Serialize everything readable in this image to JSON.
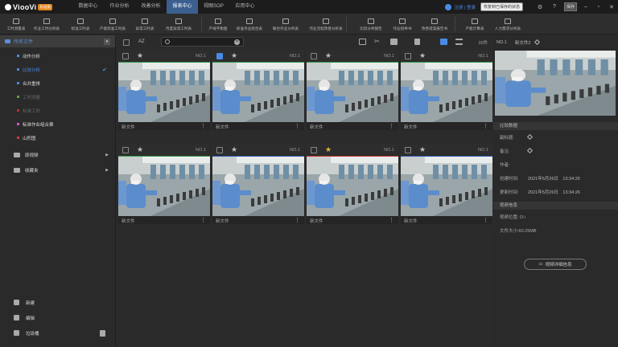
{
  "app": {
    "name": "ViooVi",
    "badge": "标准版"
  },
  "nav": [
    "数据中心",
    "作业分析",
    "改善分析",
    "报表中心",
    "视图SOP",
    "应用中心"
  ],
  "nav_active": 3,
  "topright": {
    "login": "注册 | 登录",
    "restore": "恢复到已保存的状态",
    "save": "保存"
  },
  "toolbar": [
    "工时测量表",
    "作业工时分析表",
    "标准工时表",
    "产能标准工时表",
    "异常工时表",
    "月度异常工时表",
    "产线平衡图",
    "标准作业组合表",
    "联合作业分析表",
    "作业流程改善分析表",
    "比较分析报告",
    "作业指导书",
    "改善提案报告书",
    "产能计算表",
    "人力需求分析表"
  ],
  "sidebar": {
    "root": "所有文件",
    "items": [
      {
        "label": "动作分析",
        "color": "#4a8ae6"
      },
      {
        "label": "比较分析",
        "color": "#4a8ae6",
        "selected": true
      },
      {
        "label": "合并重排",
        "color": "#4a8ae6"
      },
      {
        "label": "工时测量",
        "color": "#6b9a3b",
        "dim": true
      },
      {
        "label": "标准工时",
        "color": "#b2372e",
        "dim": true
      },
      {
        "label": "标准作业组合票",
        "color": "#d255c8"
      },
      {
        "label": "山积图",
        "color": "#d43b3b"
      }
    ],
    "groups": [
      "原视频",
      "收藏夹"
    ],
    "bottom": [
      "新建",
      "编辑",
      "垃圾桶"
    ]
  },
  "main": {
    "sort": "AZ",
    "search_placeholder": "",
    "count": "15件",
    "cards": [
      {
        "no": "NO.1",
        "name": "新文件",
        "checked": false,
        "fav": false,
        "color": "#3a9b4a"
      },
      {
        "no": "NO.1",
        "name": "新文件",
        "checked": true,
        "fav": false,
        "color": "#3a9b4a"
      },
      {
        "no": "NO.1",
        "name": "新文件",
        "checked": false,
        "fav": false,
        "color": "#3a9b4a"
      },
      {
        "no": "NO.1",
        "name": "新文件",
        "checked": false,
        "fav": false,
        "color": "#3a9b4a"
      },
      {
        "no": "NO.1",
        "name": "新文件",
        "checked": false,
        "fav": false,
        "color": "#3a9b4a"
      },
      {
        "no": "NO.1",
        "name": "新文件",
        "checked": false,
        "fav": false,
        "color": "#2f5bb0"
      },
      {
        "no": "NO.1",
        "name": "新文件",
        "checked": false,
        "fav": true,
        "color": "#c0392b"
      },
      {
        "no": "NO.1",
        "name": "新文件",
        "checked": false,
        "fav": false,
        "color": "#2f5bb0"
      }
    ]
  },
  "detail": {
    "no": "NO.1",
    "file": "新文件2",
    "section1": "比较数据",
    "labels": {
      "subtitle": "副标题:",
      "note": "备注:",
      "author": "作者:",
      "created": "创建时间:",
      "updated": "更新时间:"
    },
    "created": "2021年5月26日　13:34:26",
    "updated": "2021年5月26日　13:34:26",
    "section2": "视频信息",
    "location": "视频位置:  D:\\",
    "size": "文件大小:60.25MB",
    "button": "视频详细信息"
  },
  "colors": {
    "accent": "#4a8ae6",
    "nav_active": "#3b5f8f",
    "fav": "#e8b23a"
  }
}
